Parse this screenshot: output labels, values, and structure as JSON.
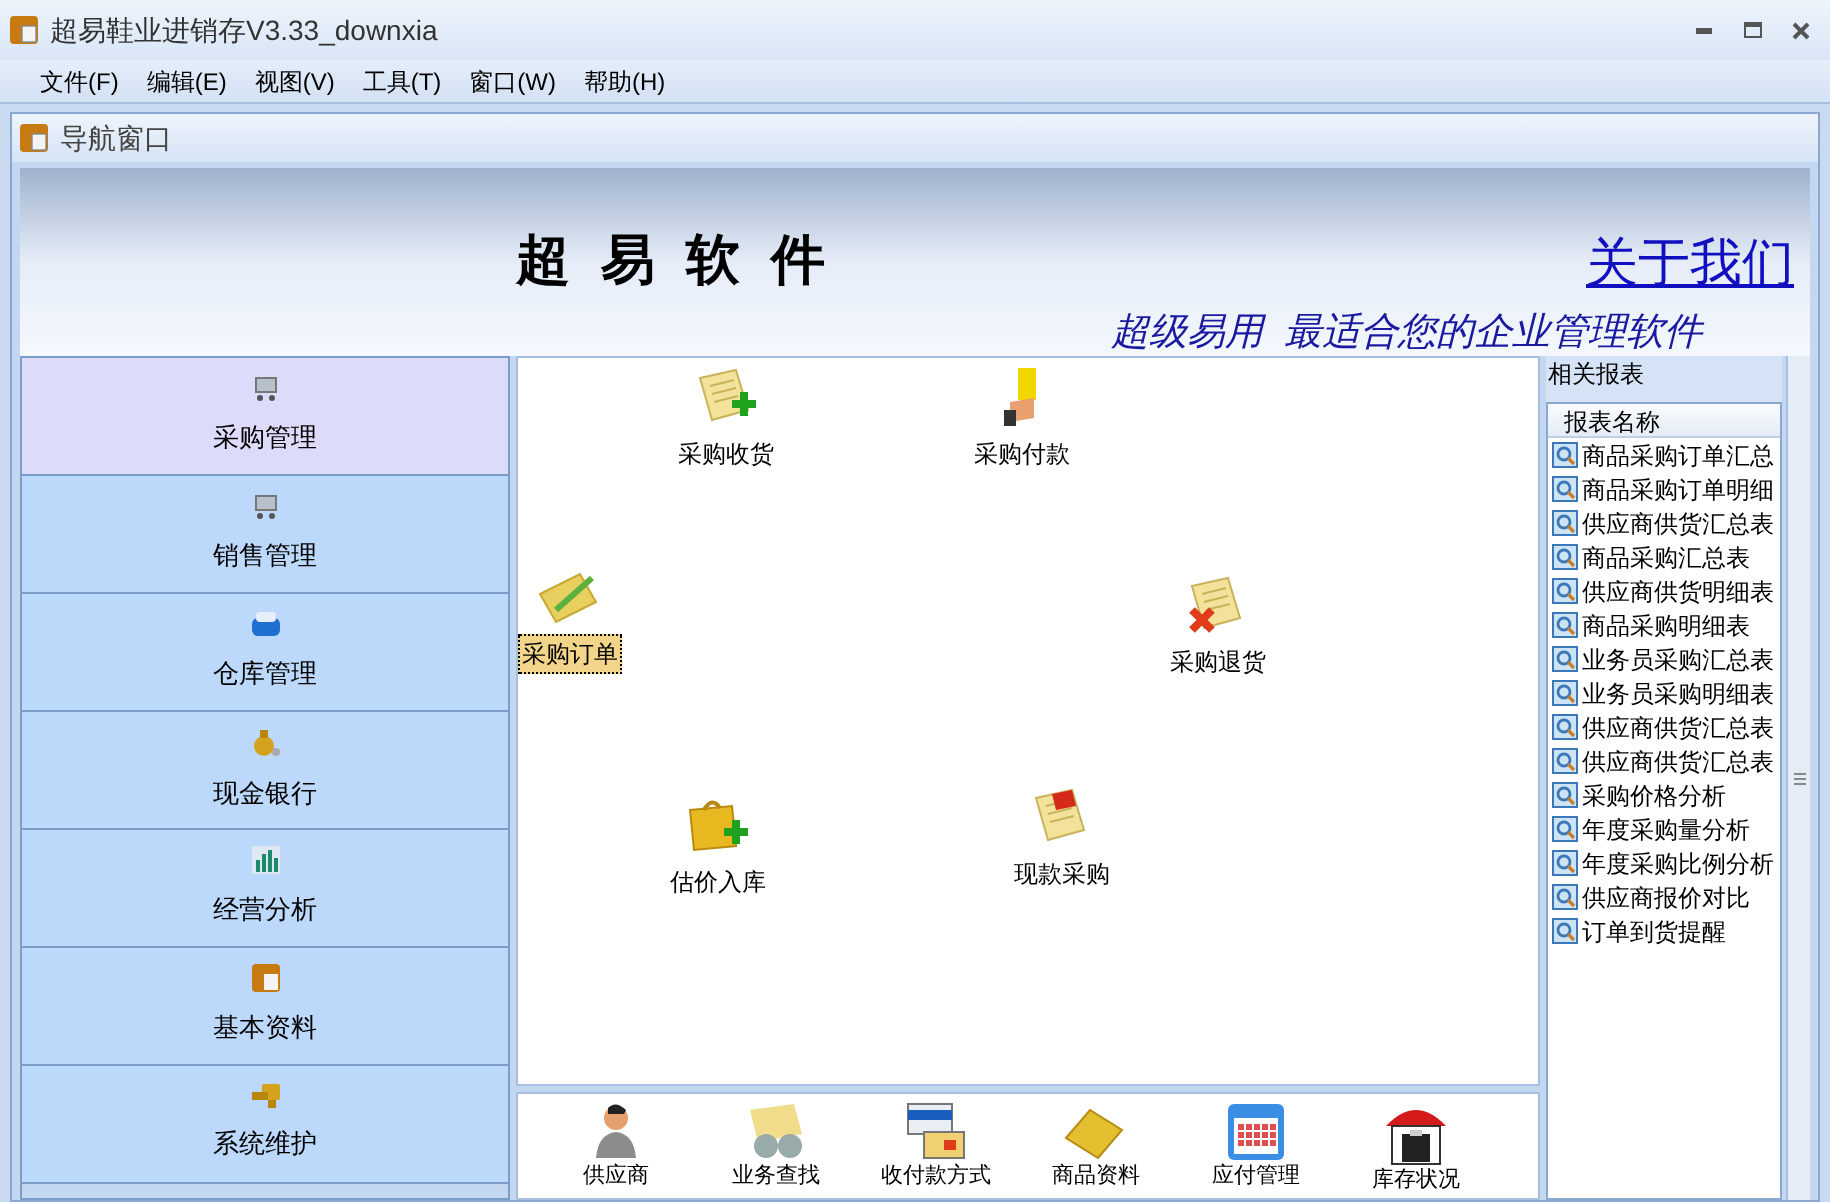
{
  "window": {
    "title": "超易鞋业进销存V3.33_downxia"
  },
  "menu": [
    "文件(F)",
    "编辑(E)",
    "视图(V)",
    "工具(T)",
    "窗口(W)",
    "帮助(H)"
  ],
  "nav_window": {
    "title": "导航窗口"
  },
  "banner": {
    "brand": "超 易 软 件",
    "about_link": "关于我们",
    "slogan": "超级易用  最适合您的企业管理软件"
  },
  "sidebar": {
    "items": [
      {
        "label": "采购管理",
        "selected": true
      },
      {
        "label": "销售管理",
        "selected": false
      },
      {
        "label": "仓库管理",
        "selected": false
      },
      {
        "label": "现金银行",
        "selected": false
      },
      {
        "label": "经营分析",
        "selected": false
      },
      {
        "label": "基本资料",
        "selected": false
      },
      {
        "label": "系统维护",
        "selected": false
      }
    ]
  },
  "canvas": {
    "items": [
      {
        "label": "采购收货",
        "selected": false
      },
      {
        "label": "采购付款",
        "selected": false
      },
      {
        "label": "采购订单",
        "selected": true
      },
      {
        "label": "采购退货",
        "selected": false
      },
      {
        "label": "估价入库",
        "selected": false
      },
      {
        "label": "现款采购",
        "selected": false
      }
    ]
  },
  "toolbar": [
    "供应商",
    "业务查找",
    "收付款方式",
    "商品资料",
    "应付管理",
    "库存状况"
  ],
  "reports": {
    "title": "相关报表",
    "column": "报表名称",
    "rows": [
      "商品采购订单汇总",
      "商品采购订单明细",
      "供应商供货汇总表",
      "商品采购汇总表",
      "供应商供货明细表",
      "商品采购明细表",
      "业务员采购汇总表",
      "业务员采购明细表",
      "供应商供货汇总表",
      "供应商供货汇总表",
      "采购价格分析",
      "年度采购量分析",
      "年度采购比例分析",
      "供应商报价对比",
      "订单到货提醒"
    ]
  }
}
